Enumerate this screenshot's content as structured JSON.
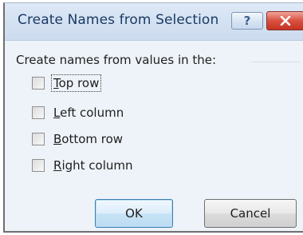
{
  "dialog": {
    "title": "Create Names from Selection",
    "instruction": "Create names from values in the:"
  },
  "titlebar_buttons": {
    "help_icon": "question-mark-icon",
    "help_glyph": "?",
    "close_icon": "close-icon"
  },
  "options": [
    {
      "mnemonic": "T",
      "rest": "op row",
      "checked": false,
      "focused": true
    },
    {
      "mnemonic": "L",
      "rest": "eft column",
      "checked": false,
      "focused": false
    },
    {
      "mnemonic": "B",
      "rest": "ottom row",
      "checked": false,
      "focused": false
    },
    {
      "mnemonic": "R",
      "rest": "ight column",
      "checked": false,
      "focused": false
    }
  ],
  "buttons": {
    "ok_label": "OK",
    "cancel_label": "Cancel"
  },
  "colors": {
    "title_text": "#1b3a63",
    "close_button": "#d9503f",
    "ok_border": "#3c7fb1"
  }
}
